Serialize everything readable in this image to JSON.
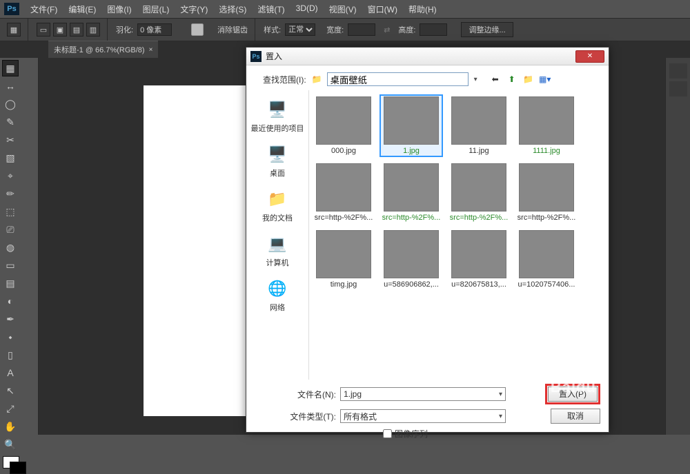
{
  "menubar": {
    "items": [
      "文件(F)",
      "编辑(E)",
      "图像(I)",
      "图层(L)",
      "文字(Y)",
      "选择(S)",
      "滤镜(T)",
      "3D(D)",
      "视图(V)",
      "窗口(W)",
      "帮助(H)"
    ]
  },
  "optbar": {
    "feather_label": "羽化:",
    "feather_value": "0 像素",
    "antialias_label": "消除锯齿",
    "style_label": "样式:",
    "style_value": "正常",
    "width_label": "宽度:",
    "height_label": "高度:",
    "refine_label": "调整边缘..."
  },
  "tab": {
    "title": "未标题-1 @ 66.7%(RGB/8)",
    "close": "×"
  },
  "tools": [
    "▦",
    "↔",
    "◯",
    "✎",
    "✂",
    "▧",
    "⌖",
    "✏",
    "⬚",
    "⎚",
    "◍",
    "▭",
    "▤",
    "◐",
    "✒",
    "⬩",
    "▯",
    "A",
    "↖",
    "⤢",
    "✋",
    "🔍"
  ],
  "dialog": {
    "title": "置入",
    "look_label": "查找范围(I):",
    "look_value": "桌面壁纸",
    "places": [
      {
        "icon": "🖥️",
        "label": "最近使用的项目"
      },
      {
        "icon": "🖥️",
        "label": "桌面"
      },
      {
        "icon": "📁",
        "label": "我的文档"
      },
      {
        "icon": "💻",
        "label": "计算机"
      },
      {
        "icon": "🌐",
        "label": "网络"
      }
    ],
    "files": [
      {
        "name": "000.jpg",
        "cls": "th-000",
        "green": false,
        "sel": false
      },
      {
        "name": "1.jpg",
        "cls": "th-1",
        "green": true,
        "sel": true
      },
      {
        "name": "11.jpg",
        "cls": "th-11",
        "green": false,
        "sel": false
      },
      {
        "name": "1111.jpg",
        "cls": "th-1111",
        "green": true,
        "sel": false
      },
      {
        "name": "src=http-%2F%...",
        "cls": "th-src1",
        "green": false,
        "sel": false
      },
      {
        "name": "src=http-%2F%...",
        "cls": "th-src2",
        "green": true,
        "sel": false
      },
      {
        "name": "src=http-%2F%...",
        "cls": "th-src3",
        "green": true,
        "sel": false
      },
      {
        "name": "src=http-%2F%...",
        "cls": "th-src4",
        "green": false,
        "sel": false
      },
      {
        "name": "timg.jpg",
        "cls": "th-timg",
        "green": false,
        "sel": false
      },
      {
        "name": "u=586906862,...",
        "cls": "th-u5",
        "green": false,
        "sel": false
      },
      {
        "name": "u=820675813,...",
        "cls": "th-u8",
        "green": false,
        "sel": false
      },
      {
        "name": "u=1020757406...",
        "cls": "th-u1",
        "green": false,
        "sel": false
      }
    ],
    "filename_label": "文件名(N):",
    "filename_value": "1.jpg",
    "filetype_label": "文件类型(T):",
    "filetype_value": "所有格式",
    "place_btn": "置入(P)",
    "cancel_btn": "取消",
    "sequence_label": "图像序列"
  }
}
